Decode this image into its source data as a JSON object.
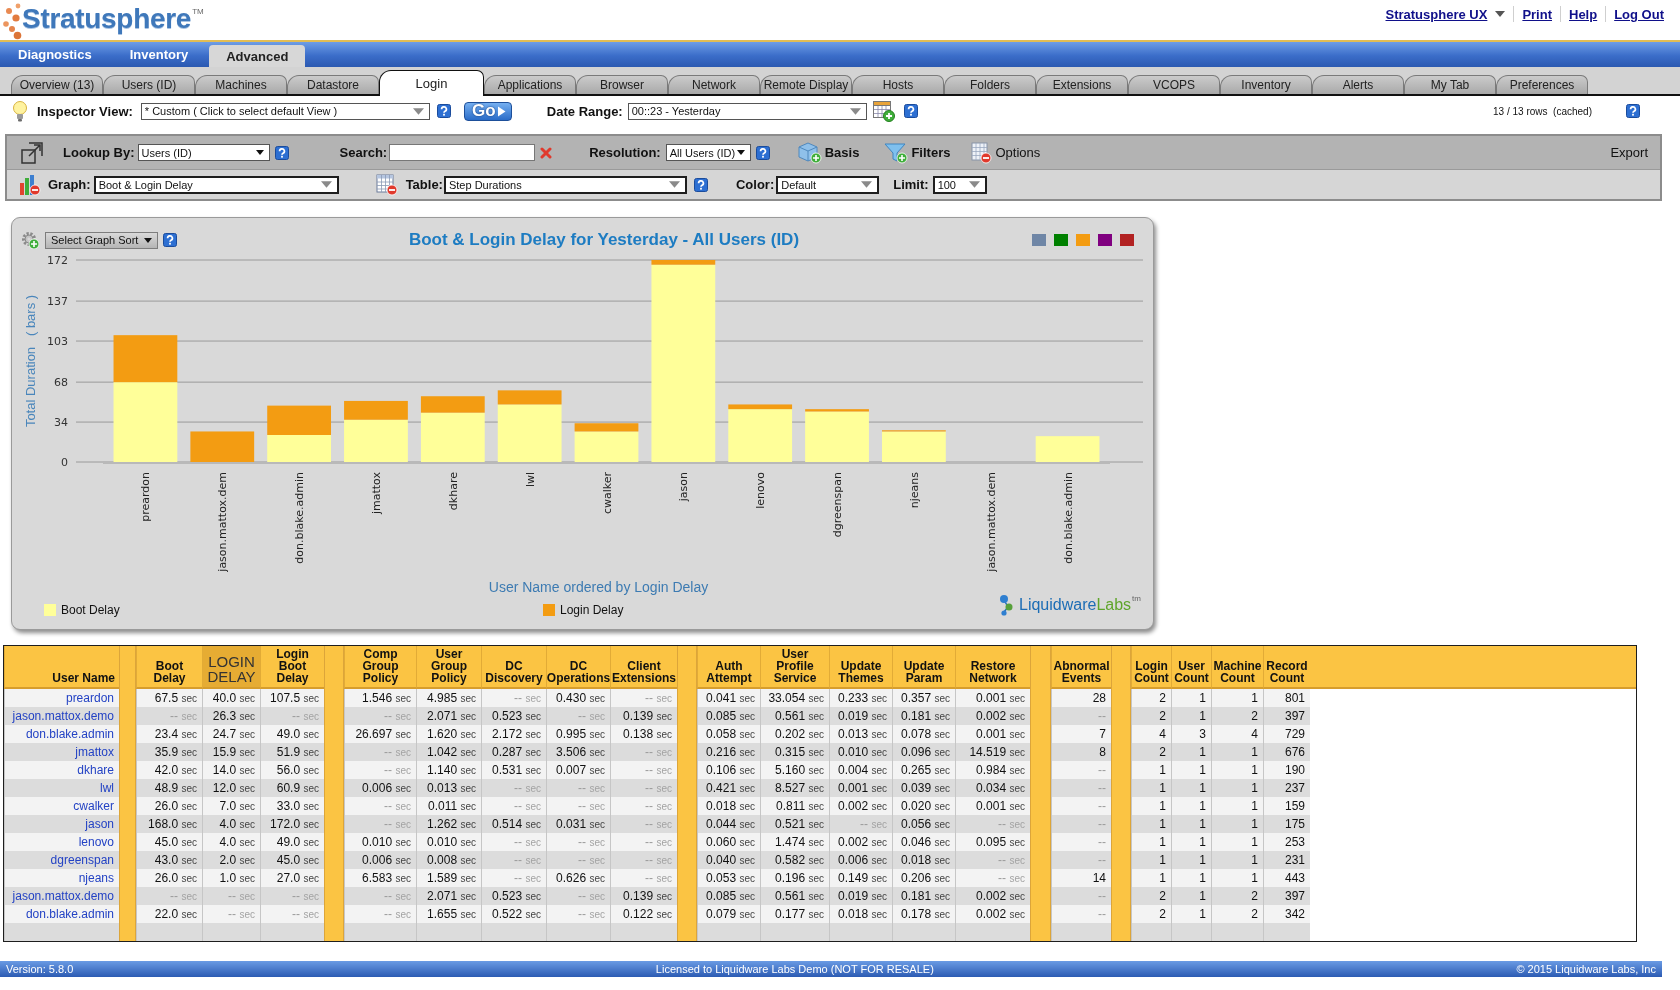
{
  "header": {
    "logo": {
      "text": "Stratusphere",
      "mark": "TM"
    },
    "links": [
      {
        "label": "Stratusphere UX",
        "kind": "menu"
      },
      {
        "label": "Print",
        "kind": "link"
      },
      {
        "label": "Help",
        "kind": "link"
      },
      {
        "label": "Log Out",
        "kind": "link"
      }
    ]
  },
  "main_tabs": [
    {
      "label": "Diagnostics",
      "selected": false
    },
    {
      "label": "Inventory",
      "selected": false
    },
    {
      "label": "Advanced",
      "selected": true
    }
  ],
  "sub_tabs": [
    {
      "label": "Overview (13)",
      "selected": false
    },
    {
      "label": "Users (ID)",
      "selected": false
    },
    {
      "label": "Machines",
      "selected": false
    },
    {
      "label": "Datastore",
      "selected": false
    },
    {
      "label": "Login",
      "selected": true
    },
    {
      "label": "Applications",
      "selected": false
    },
    {
      "label": "Browser",
      "selected": false
    },
    {
      "label": "Network",
      "selected": false
    },
    {
      "label": "Remote Display",
      "selected": false
    },
    {
      "label": "Hosts",
      "selected": false
    },
    {
      "label": "Folders",
      "selected": false
    },
    {
      "label": "Extensions",
      "selected": false
    },
    {
      "label": "VCOPS",
      "selected": false
    },
    {
      "label": "Inventory",
      "selected": false
    },
    {
      "label": "Alerts",
      "selected": false
    },
    {
      "label": "My Tab",
      "selected": false
    },
    {
      "label": "Preferences",
      "selected": false
    }
  ],
  "inspector_bar": {
    "inspector_view": {
      "label": "Inspector View:",
      "value": "* Custom ( Click to select default View )"
    },
    "go_button": "Go",
    "date_range": {
      "label": "Date Range:",
      "value": "00::23 - Yesterday"
    },
    "row_status": "13 / 13 rows  (cached)"
  },
  "toolbar": {
    "lookup_by": {
      "label": "Lookup By:",
      "value": "Users (ID)"
    },
    "search": {
      "label": "Search:"
    },
    "resolution": {
      "label": "Resolution:",
      "value": "All Users (ID)"
    },
    "actions": [
      {
        "label": "Basis",
        "kind": "basis"
      },
      {
        "label": "Filters",
        "kind": "filters"
      },
      {
        "label": "Options",
        "kind": "options"
      }
    ],
    "export": "Export",
    "graph": {
      "label": "Graph:",
      "value": "Boot & Login Delay"
    },
    "table": {
      "label": "Table:",
      "value": "Step Durations"
    },
    "color": {
      "label": "Color:",
      "value": "Default"
    },
    "limit": {
      "label": "Limit:",
      "value": "100"
    }
  },
  "chart": {
    "sort_button": "Select Graph Sort",
    "color_swatches": [
      {
        "color": "#6f86a6"
      },
      {
        "color": "#008000"
      },
      {
        "color": "#f39c12"
      },
      {
        "color": "#800080"
      },
      {
        "color": "#b22222"
      }
    ],
    "chart_data": {
      "type": "bar",
      "stacked": true,
      "grid": true,
      "legend": true,
      "title": "Boot & Login Delay for Yesterday - All Users (ID)",
      "xlabel": "User Name ordered by Login Delay",
      "ylabel": "Total Duration   ( bars )",
      "categories": [
        "preardon",
        "jason.mattox.dem",
        "don.blake.admin",
        "jmattox",
        "dkhare",
        "lwl",
        "cwalker",
        "jason",
        "lenovo",
        "dgreenspan",
        "njeans",
        "jason.mattox.dem",
        "don.blake.admin"
      ],
      "series": [
        {
          "name": "Boot Delay",
          "color": "#ffff99",
          "values": [
            68,
            0,
            23,
            36,
            42,
            49,
            26,
            168,
            45,
            43,
            26,
            0,
            22
          ]
        },
        {
          "name": "Login Delay",
          "color": "#f39c12",
          "values": [
            40,
            26,
            25,
            16,
            14,
            12,
            7,
            4,
            4,
            2,
            1,
            0,
            0
          ]
        }
      ],
      "ylim": [
        0,
        172
      ],
      "yticks": [
        0,
        34,
        68,
        103,
        137,
        172
      ]
    },
    "logo": {
      "name": "Liquidware",
      "suffix": "Labs",
      "mark": "tm"
    }
  },
  "table": {
    "column_groups": [
      [
        {
          "label": "User Name",
          "sorted": false
        }
      ],
      [
        {
          "label": "Boot Delay",
          "sorted": false
        },
        {
          "label": "LOGIN DELAY",
          "sorted": true
        },
        {
          "label": "Login Boot Delay",
          "sorted": false
        }
      ],
      [
        {
          "label": "Comp Group Policy",
          "sorted": false
        },
        {
          "label": "User Group Policy",
          "sorted": false
        },
        {
          "label": "DC Discovery",
          "sorted": false
        },
        {
          "label": "DC Operations",
          "sorted": false
        },
        {
          "label": "Client Extensions",
          "sorted": false
        }
      ],
      [
        {
          "label": "Auth Attempt",
          "sorted": false
        },
        {
          "label": "User Profile Service",
          "sorted": false
        },
        {
          "label": "Update Themes",
          "sorted": false
        },
        {
          "label": "Update Param",
          "sorted": false
        },
        {
          "label": "Restore Network",
          "sorted": false
        }
      ],
      [
        {
          "label": "Abnormal Events",
          "sorted": false
        }
      ],
      [
        {
          "label": "Login Count",
          "sorted": false
        },
        {
          "label": "User Count",
          "sorted": false
        },
        {
          "label": "Machine Count",
          "sorted": false
        },
        {
          "label": "Record Count",
          "sorted": false
        }
      ]
    ],
    "rows": [
      {
        "user": "preardon",
        "cells": [
          {
            "value": "67.5",
            "unit": "sec",
            "missing": false
          },
          {
            "value": "40.0",
            "unit": "sec",
            "missing": false
          },
          {
            "value": "107.5",
            "unit": "sec",
            "missing": false
          },
          {
            "value": "1.546",
            "unit": "sec",
            "missing": false
          },
          {
            "value": "4.985",
            "unit": "sec",
            "missing": false
          },
          {
            "value": "--",
            "unit": "sec",
            "missing": true
          },
          {
            "value": "0.430",
            "unit": "sec",
            "missing": false
          },
          {
            "value": "--",
            "unit": "sec",
            "missing": true
          },
          {
            "value": "0.041",
            "unit": "sec",
            "missing": false
          },
          {
            "value": "33.054",
            "unit": "sec",
            "missing": false
          },
          {
            "value": "0.233",
            "unit": "sec",
            "missing": false
          },
          {
            "value": "0.357",
            "unit": "sec",
            "missing": false
          },
          {
            "value": "0.001",
            "unit": "sec",
            "missing": false
          },
          {
            "value": "28",
            "missing": false
          },
          {
            "value": "2",
            "missing": false
          },
          {
            "value": "1",
            "missing": false
          },
          {
            "value": "1",
            "missing": false
          },
          {
            "value": "801",
            "missing": false
          }
        ]
      },
      {
        "user": "jason.mattox.demo",
        "cells": [
          {
            "value": "--",
            "unit": "sec",
            "missing": true
          },
          {
            "value": "26.3",
            "unit": "sec",
            "missing": false
          },
          {
            "value": "--",
            "unit": "sec",
            "missing": true
          },
          {
            "value": "--",
            "unit": "sec",
            "missing": true
          },
          {
            "value": "2.071",
            "unit": "sec",
            "missing": false
          },
          {
            "value": "0.523",
            "unit": "sec",
            "missing": false
          },
          {
            "value": "--",
            "unit": "sec",
            "missing": true
          },
          {
            "value": "0.139",
            "unit": "sec",
            "missing": false
          },
          {
            "value": "0.085",
            "unit": "sec",
            "missing": false
          },
          {
            "value": "0.561",
            "unit": "sec",
            "missing": false
          },
          {
            "value": "0.019",
            "unit": "sec",
            "missing": false
          },
          {
            "value": "0.181",
            "unit": "sec",
            "missing": false
          },
          {
            "value": "0.002",
            "unit": "sec",
            "missing": false
          },
          {
            "value": "--",
            "missing": true
          },
          {
            "value": "2",
            "missing": false
          },
          {
            "value": "1",
            "missing": false
          },
          {
            "value": "2",
            "missing": false
          },
          {
            "value": "397",
            "missing": false
          }
        ]
      },
      {
        "user": "don.blake.admin",
        "cells": [
          {
            "value": "23.4",
            "unit": "sec",
            "missing": false
          },
          {
            "value": "24.7",
            "unit": "sec",
            "missing": false
          },
          {
            "value": "49.0",
            "unit": "sec",
            "missing": false
          },
          {
            "value": "26.697",
            "unit": "sec",
            "missing": false
          },
          {
            "value": "1.620",
            "unit": "sec",
            "missing": false
          },
          {
            "value": "2.172",
            "unit": "sec",
            "missing": false
          },
          {
            "value": "0.995",
            "unit": "sec",
            "missing": false
          },
          {
            "value": "0.138",
            "unit": "sec",
            "missing": false
          },
          {
            "value": "0.058",
            "unit": "sec",
            "missing": false
          },
          {
            "value": "0.202",
            "unit": "sec",
            "missing": false
          },
          {
            "value": "0.013",
            "unit": "sec",
            "missing": false
          },
          {
            "value": "0.078",
            "unit": "sec",
            "missing": false
          },
          {
            "value": "0.001",
            "unit": "sec",
            "missing": false
          },
          {
            "value": "7",
            "missing": false
          },
          {
            "value": "4",
            "missing": false
          },
          {
            "value": "3",
            "missing": false
          },
          {
            "value": "4",
            "missing": false
          },
          {
            "value": "729",
            "missing": false
          }
        ]
      },
      {
        "user": "jmattox",
        "cells": [
          {
            "value": "35.9",
            "unit": "sec",
            "missing": false
          },
          {
            "value": "15.9",
            "unit": "sec",
            "missing": false
          },
          {
            "value": "51.9",
            "unit": "sec",
            "missing": false
          },
          {
            "value": "--",
            "unit": "sec",
            "missing": true
          },
          {
            "value": "1.042",
            "unit": "sec",
            "missing": false
          },
          {
            "value": "0.287",
            "unit": "sec",
            "missing": false
          },
          {
            "value": "3.506",
            "unit": "sec",
            "missing": false
          },
          {
            "value": "--",
            "unit": "sec",
            "missing": true
          },
          {
            "value": "0.216",
            "unit": "sec",
            "missing": false
          },
          {
            "value": "0.315",
            "unit": "sec",
            "missing": false
          },
          {
            "value": "0.010",
            "unit": "sec",
            "missing": false
          },
          {
            "value": "0.096",
            "unit": "sec",
            "missing": false
          },
          {
            "value": "14.519",
            "unit": "sec",
            "missing": false
          },
          {
            "value": "8",
            "missing": false
          },
          {
            "value": "2",
            "missing": false
          },
          {
            "value": "1",
            "missing": false
          },
          {
            "value": "1",
            "missing": false
          },
          {
            "value": "676",
            "missing": false
          }
        ]
      },
      {
        "user": "dkhare",
        "cells": [
          {
            "value": "42.0",
            "unit": "sec",
            "missing": false
          },
          {
            "value": "14.0",
            "unit": "sec",
            "missing": false
          },
          {
            "value": "56.0",
            "unit": "sec",
            "missing": false
          },
          {
            "value": "--",
            "unit": "sec",
            "missing": true
          },
          {
            "value": "1.140",
            "unit": "sec",
            "missing": false
          },
          {
            "value": "0.531",
            "unit": "sec",
            "missing": false
          },
          {
            "value": "0.007",
            "unit": "sec",
            "missing": false
          },
          {
            "value": "--",
            "unit": "sec",
            "missing": true
          },
          {
            "value": "0.106",
            "unit": "sec",
            "missing": false
          },
          {
            "value": "5.160",
            "unit": "sec",
            "missing": false
          },
          {
            "value": "0.004",
            "unit": "sec",
            "missing": false
          },
          {
            "value": "0.265",
            "unit": "sec",
            "missing": false
          },
          {
            "value": "0.984",
            "unit": "sec",
            "missing": false
          },
          {
            "value": "--",
            "missing": true
          },
          {
            "value": "1",
            "missing": false
          },
          {
            "value": "1",
            "missing": false
          },
          {
            "value": "1",
            "missing": false
          },
          {
            "value": "190",
            "missing": false
          }
        ]
      },
      {
        "user": "lwl",
        "cells": [
          {
            "value": "48.9",
            "unit": "sec",
            "missing": false
          },
          {
            "value": "12.0",
            "unit": "sec",
            "missing": false
          },
          {
            "value": "60.9",
            "unit": "sec",
            "missing": false
          },
          {
            "value": "0.006",
            "unit": "sec",
            "missing": false
          },
          {
            "value": "0.013",
            "unit": "sec",
            "missing": false
          },
          {
            "value": "--",
            "unit": "sec",
            "missing": true
          },
          {
            "value": "--",
            "unit": "sec",
            "missing": true
          },
          {
            "value": "--",
            "unit": "sec",
            "missing": true
          },
          {
            "value": "0.421",
            "unit": "sec",
            "missing": false
          },
          {
            "value": "8.527",
            "unit": "sec",
            "missing": false
          },
          {
            "value": "0.001",
            "unit": "sec",
            "missing": false
          },
          {
            "value": "0.039",
            "unit": "sec",
            "missing": false
          },
          {
            "value": "0.034",
            "unit": "sec",
            "missing": false
          },
          {
            "value": "--",
            "missing": true
          },
          {
            "value": "1",
            "missing": false
          },
          {
            "value": "1",
            "missing": false
          },
          {
            "value": "1",
            "missing": false
          },
          {
            "value": "237",
            "missing": false
          }
        ]
      },
      {
        "user": "cwalker",
        "cells": [
          {
            "value": "26.0",
            "unit": "sec",
            "missing": false
          },
          {
            "value": "7.0",
            "unit": "sec",
            "missing": false
          },
          {
            "value": "33.0",
            "unit": "sec",
            "missing": false
          },
          {
            "value": "--",
            "unit": "sec",
            "missing": true
          },
          {
            "value": "0.011",
            "unit": "sec",
            "missing": false
          },
          {
            "value": "--",
            "unit": "sec",
            "missing": true
          },
          {
            "value": "--",
            "unit": "sec",
            "missing": true
          },
          {
            "value": "--",
            "unit": "sec",
            "missing": true
          },
          {
            "value": "0.018",
            "unit": "sec",
            "missing": false
          },
          {
            "value": "0.811",
            "unit": "sec",
            "missing": false
          },
          {
            "value": "0.002",
            "unit": "sec",
            "missing": false
          },
          {
            "value": "0.020",
            "unit": "sec",
            "missing": false
          },
          {
            "value": "0.001",
            "unit": "sec",
            "missing": false
          },
          {
            "value": "--",
            "missing": true
          },
          {
            "value": "1",
            "missing": false
          },
          {
            "value": "1",
            "missing": false
          },
          {
            "value": "1",
            "missing": false
          },
          {
            "value": "159",
            "missing": false
          }
        ]
      },
      {
        "user": "jason",
        "cells": [
          {
            "value": "168.0",
            "unit": "sec",
            "missing": false
          },
          {
            "value": "4.0",
            "unit": "sec",
            "missing": false
          },
          {
            "value": "172.0",
            "unit": "sec",
            "missing": false
          },
          {
            "value": "--",
            "unit": "sec",
            "missing": true
          },
          {
            "value": "1.262",
            "unit": "sec",
            "missing": false
          },
          {
            "value": "0.514",
            "unit": "sec",
            "missing": false
          },
          {
            "value": "0.031",
            "unit": "sec",
            "missing": false
          },
          {
            "value": "--",
            "unit": "sec",
            "missing": true
          },
          {
            "value": "0.044",
            "unit": "sec",
            "missing": false
          },
          {
            "value": "0.521",
            "unit": "sec",
            "missing": false
          },
          {
            "value": "--",
            "unit": "sec",
            "missing": true
          },
          {
            "value": "0.056",
            "unit": "sec",
            "missing": false
          },
          {
            "value": "--",
            "unit": "sec",
            "missing": true
          },
          {
            "value": "--",
            "missing": true
          },
          {
            "value": "1",
            "missing": false
          },
          {
            "value": "1",
            "missing": false
          },
          {
            "value": "1",
            "missing": false
          },
          {
            "value": "175",
            "missing": false
          }
        ]
      },
      {
        "user": "lenovo",
        "cells": [
          {
            "value": "45.0",
            "unit": "sec",
            "missing": false
          },
          {
            "value": "4.0",
            "unit": "sec",
            "missing": false
          },
          {
            "value": "49.0",
            "unit": "sec",
            "missing": false
          },
          {
            "value": "0.010",
            "unit": "sec",
            "missing": false
          },
          {
            "value": "0.010",
            "unit": "sec",
            "missing": false
          },
          {
            "value": "--",
            "unit": "sec",
            "missing": true
          },
          {
            "value": "--",
            "unit": "sec",
            "missing": true
          },
          {
            "value": "--",
            "unit": "sec",
            "missing": true
          },
          {
            "value": "0.060",
            "unit": "sec",
            "missing": false
          },
          {
            "value": "1.474",
            "unit": "sec",
            "missing": false
          },
          {
            "value": "0.002",
            "unit": "sec",
            "missing": false
          },
          {
            "value": "0.046",
            "unit": "sec",
            "missing": false
          },
          {
            "value": "0.095",
            "unit": "sec",
            "missing": false
          },
          {
            "value": "--",
            "missing": true
          },
          {
            "value": "1",
            "missing": false
          },
          {
            "value": "1",
            "missing": false
          },
          {
            "value": "1",
            "missing": false
          },
          {
            "value": "253",
            "missing": false
          }
        ]
      },
      {
        "user": "dgreenspan",
        "cells": [
          {
            "value": "43.0",
            "unit": "sec",
            "missing": false
          },
          {
            "value": "2.0",
            "unit": "sec",
            "missing": false
          },
          {
            "value": "45.0",
            "unit": "sec",
            "missing": false
          },
          {
            "value": "0.006",
            "unit": "sec",
            "missing": false
          },
          {
            "value": "0.008",
            "unit": "sec",
            "missing": false
          },
          {
            "value": "--",
            "unit": "sec",
            "missing": true
          },
          {
            "value": "--",
            "unit": "sec",
            "missing": true
          },
          {
            "value": "--",
            "unit": "sec",
            "missing": true
          },
          {
            "value": "0.040",
            "unit": "sec",
            "missing": false
          },
          {
            "value": "0.582",
            "unit": "sec",
            "missing": false
          },
          {
            "value": "0.006",
            "unit": "sec",
            "missing": false
          },
          {
            "value": "0.018",
            "unit": "sec",
            "missing": false
          },
          {
            "value": "--",
            "unit": "sec",
            "missing": true
          },
          {
            "value": "--",
            "missing": true
          },
          {
            "value": "1",
            "missing": false
          },
          {
            "value": "1",
            "missing": false
          },
          {
            "value": "1",
            "missing": false
          },
          {
            "value": "231",
            "missing": false
          }
        ]
      },
      {
        "user": "njeans",
        "cells": [
          {
            "value": "26.0",
            "unit": "sec",
            "missing": false
          },
          {
            "value": "1.0",
            "unit": "sec",
            "missing": false
          },
          {
            "value": "27.0",
            "unit": "sec",
            "missing": false
          },
          {
            "value": "6.583",
            "unit": "sec",
            "missing": false
          },
          {
            "value": "1.589",
            "unit": "sec",
            "missing": false
          },
          {
            "value": "--",
            "unit": "sec",
            "missing": true
          },
          {
            "value": "0.626",
            "unit": "sec",
            "missing": false
          },
          {
            "value": "--",
            "unit": "sec",
            "missing": true
          },
          {
            "value": "0.053",
            "unit": "sec",
            "missing": false
          },
          {
            "value": "0.196",
            "unit": "sec",
            "missing": false
          },
          {
            "value": "0.149",
            "unit": "sec",
            "missing": false
          },
          {
            "value": "0.206",
            "unit": "sec",
            "missing": false
          },
          {
            "value": "--",
            "unit": "sec",
            "missing": true
          },
          {
            "value": "14",
            "missing": false
          },
          {
            "value": "1",
            "missing": false
          },
          {
            "value": "1",
            "missing": false
          },
          {
            "value": "1",
            "missing": false
          },
          {
            "value": "443",
            "missing": false
          }
        ]
      },
      {
        "user": "jason.mattox.demo",
        "cells": [
          {
            "value": "--",
            "unit": "sec",
            "missing": true
          },
          {
            "value": "--",
            "unit": "sec",
            "missing": true
          },
          {
            "value": "--",
            "unit": "sec",
            "missing": true
          },
          {
            "value": "--",
            "unit": "sec",
            "missing": true
          },
          {
            "value": "2.071",
            "unit": "sec",
            "missing": false
          },
          {
            "value": "0.523",
            "unit": "sec",
            "missing": false
          },
          {
            "value": "--",
            "unit": "sec",
            "missing": true
          },
          {
            "value": "0.139",
            "unit": "sec",
            "missing": false
          },
          {
            "value": "0.085",
            "unit": "sec",
            "missing": false
          },
          {
            "value": "0.561",
            "unit": "sec",
            "missing": false
          },
          {
            "value": "0.019",
            "unit": "sec",
            "missing": false
          },
          {
            "value": "0.181",
            "unit": "sec",
            "missing": false
          },
          {
            "value": "0.002",
            "unit": "sec",
            "missing": false
          },
          {
            "value": "--",
            "missing": true
          },
          {
            "value": "2",
            "missing": false
          },
          {
            "value": "1",
            "missing": false
          },
          {
            "value": "2",
            "missing": false
          },
          {
            "value": "397",
            "missing": false
          }
        ]
      },
      {
        "user": "don.blake.admin",
        "cells": [
          {
            "value": "22.0",
            "unit": "sec",
            "missing": false
          },
          {
            "value": "--",
            "unit": "sec",
            "missing": true
          },
          {
            "value": "--",
            "unit": "sec",
            "missing": true
          },
          {
            "value": "--",
            "unit": "sec",
            "missing": true
          },
          {
            "value": "1.655",
            "unit": "sec",
            "missing": false
          },
          {
            "value": "0.522",
            "unit": "sec",
            "missing": false
          },
          {
            "value": "--",
            "unit": "sec",
            "missing": true
          },
          {
            "value": "0.122",
            "unit": "sec",
            "missing": false
          },
          {
            "value": "0.079",
            "unit": "sec",
            "missing": false
          },
          {
            "value": "0.177",
            "unit": "sec",
            "missing": false
          },
          {
            "value": "0.018",
            "unit": "sec",
            "missing": false
          },
          {
            "value": "0.178",
            "unit": "sec",
            "missing": false
          },
          {
            "value": "0.002",
            "unit": "sec",
            "missing": false
          },
          {
            "value": "--",
            "missing": true
          },
          {
            "value": "2",
            "missing": false
          },
          {
            "value": "1",
            "missing": false
          },
          {
            "value": "2",
            "missing": false
          },
          {
            "value": "342",
            "missing": false
          }
        ]
      }
    ]
  },
  "footer": {
    "version": "Version: 5.8.0",
    "license": "Licensed to Liquidware Labs Demo (NOT FOR RESALE)",
    "copyright": "© 2015 Liquidware Labs, Inc"
  }
}
